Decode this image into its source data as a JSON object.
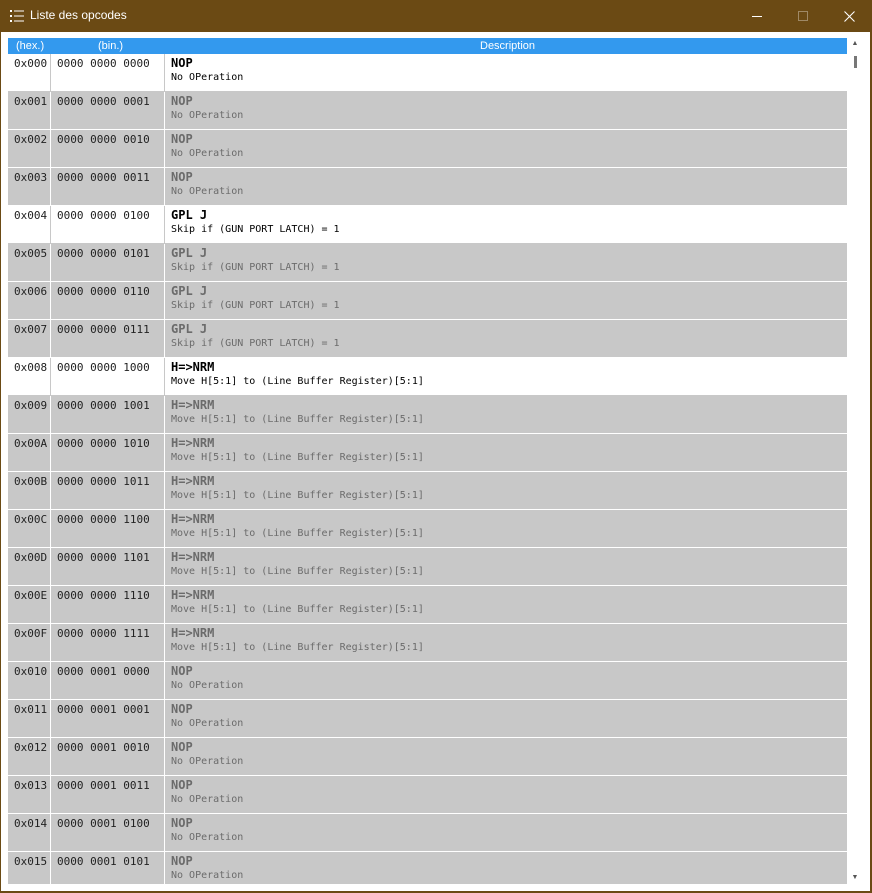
{
  "window": {
    "title": "Liste des opcodes",
    "title_icon": "list-icon",
    "controls": {
      "minimize_icon": "minimize-icon",
      "maximize_icon": "maximize-icon",
      "close_icon": "close-icon"
    }
  },
  "table": {
    "headers": {
      "hex": "(hex.)",
      "bin": "(bin.)",
      "description": "Description"
    },
    "rows": [
      {
        "hex": "0x000",
        "bin": "0000 0000 0000",
        "name": "NOP",
        "desc": "No OPeration",
        "active": true
      },
      {
        "hex": "0x001",
        "bin": "0000 0000 0001",
        "name": "NOP",
        "desc": "No OPeration",
        "active": false
      },
      {
        "hex": "0x002",
        "bin": "0000 0000 0010",
        "name": "NOP",
        "desc": "No OPeration",
        "active": false
      },
      {
        "hex": "0x003",
        "bin": "0000 0000 0011",
        "name": "NOP",
        "desc": "No OPeration",
        "active": false
      },
      {
        "hex": "0x004",
        "bin": "0000 0000 0100",
        "name": "GPL J",
        "desc": "Skip if (GUN PORT LATCH) = 1",
        "active": true
      },
      {
        "hex": "0x005",
        "bin": "0000 0000 0101",
        "name": "GPL J",
        "desc": "Skip if (GUN PORT LATCH) = 1",
        "active": false
      },
      {
        "hex": "0x006",
        "bin": "0000 0000 0110",
        "name": "GPL J",
        "desc": "Skip if (GUN PORT LATCH) = 1",
        "active": false
      },
      {
        "hex": "0x007",
        "bin": "0000 0000 0111",
        "name": "GPL J",
        "desc": "Skip if (GUN PORT LATCH) = 1",
        "active": false
      },
      {
        "hex": "0x008",
        "bin": "0000 0000 1000",
        "name": "H=>NRM",
        "desc": "Move H[5:1] to (Line Buffer Register)[5:1]",
        "active": true
      },
      {
        "hex": "0x009",
        "bin": "0000 0000 1001",
        "name": "H=>NRM",
        "desc": "Move H[5:1] to (Line Buffer Register)[5:1]",
        "active": false
      },
      {
        "hex": "0x00A",
        "bin": "0000 0000 1010",
        "name": "H=>NRM",
        "desc": "Move H[5:1] to (Line Buffer Register)[5:1]",
        "active": false
      },
      {
        "hex": "0x00B",
        "bin": "0000 0000 1011",
        "name": "H=>NRM",
        "desc": "Move H[5:1] to (Line Buffer Register)[5:1]",
        "active": false
      },
      {
        "hex": "0x00C",
        "bin": "0000 0000 1100",
        "name": "H=>NRM",
        "desc": "Move H[5:1] to (Line Buffer Register)[5:1]",
        "active": false
      },
      {
        "hex": "0x00D",
        "bin": "0000 0000 1101",
        "name": "H=>NRM",
        "desc": "Move H[5:1] to (Line Buffer Register)[5:1]",
        "active": false
      },
      {
        "hex": "0x00E",
        "bin": "0000 0000 1110",
        "name": "H=>NRM",
        "desc": "Move H[5:1] to (Line Buffer Register)[5:1]",
        "active": false
      },
      {
        "hex": "0x00F",
        "bin": "0000 0000 1111",
        "name": "H=>NRM",
        "desc": "Move H[5:1] to (Line Buffer Register)[5:1]",
        "active": false
      },
      {
        "hex": "0x010",
        "bin": "0000 0001 0000",
        "name": "NOP",
        "desc": "No OPeration",
        "active": false
      },
      {
        "hex": "0x011",
        "bin": "0000 0001 0001",
        "name": "NOP",
        "desc": "No OPeration",
        "active": false
      },
      {
        "hex": "0x012",
        "bin": "0000 0001 0010",
        "name": "NOP",
        "desc": "No OPeration",
        "active": false
      },
      {
        "hex": "0x013",
        "bin": "0000 0001 0011",
        "name": "NOP",
        "desc": "No OPeration",
        "active": false
      },
      {
        "hex": "0x014",
        "bin": "0000 0001 0100",
        "name": "NOP",
        "desc": "No OPeration",
        "active": false
      },
      {
        "hex": "0x015",
        "bin": "0000 0001 0101",
        "name": "NOP",
        "desc": "No OPeration",
        "active": false
      }
    ]
  },
  "colors": {
    "titlebar": "#6b4a14",
    "header": "#3399ee",
    "row_inactive": "#c8c8c8",
    "row_active": "#ffffff"
  }
}
